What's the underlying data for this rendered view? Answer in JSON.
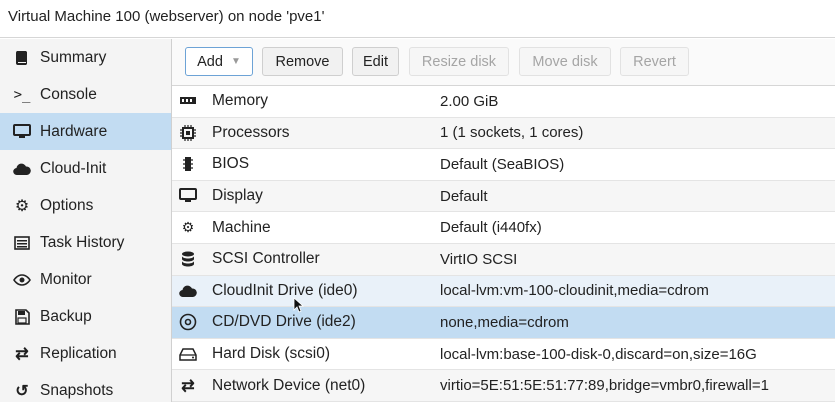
{
  "window": {
    "title": "Virtual Machine 100 (webserver) on node 'pve1'"
  },
  "sidebar": {
    "items": [
      {
        "label": "Summary",
        "icon": "book-icon"
      },
      {
        "label": "Console",
        "icon": "terminal-icon"
      },
      {
        "label": "Hardware",
        "icon": "monitor-icon",
        "active": true
      },
      {
        "label": "Cloud-Init",
        "icon": "cloud-icon"
      },
      {
        "label": "Options",
        "icon": "gear-icon"
      },
      {
        "label": "Task History",
        "icon": "list-icon"
      },
      {
        "label": "Monitor",
        "icon": "eye-icon"
      },
      {
        "label": "Backup",
        "icon": "floppy-icon"
      },
      {
        "label": "Replication",
        "icon": "retweet-icon"
      },
      {
        "label": "Snapshots",
        "icon": "history-icon"
      }
    ]
  },
  "toolbar": {
    "add": "Add",
    "remove": "Remove",
    "edit": "Edit",
    "resize": "Resize disk",
    "move": "Move disk",
    "revert": "Revert"
  },
  "hardware": {
    "rows": [
      {
        "name": "Memory",
        "value": "2.00 GiB",
        "icon": "memory-icon"
      },
      {
        "name": "Processors",
        "value": "1 (1 sockets, 1 cores)",
        "icon": "cpu-icon"
      },
      {
        "name": "BIOS",
        "value": "Default (SeaBIOS)",
        "icon": "chip-icon"
      },
      {
        "name": "Display",
        "value": "Default",
        "icon": "display-icon"
      },
      {
        "name": "Machine",
        "value": "Default (i440fx)",
        "icon": "cogs-icon"
      },
      {
        "name": "SCSI Controller",
        "value": "VirtIO SCSI",
        "icon": "database-icon"
      },
      {
        "name": "CloudInit Drive (ide0)",
        "value": "local-lvm:vm-100-cloudinit,media=cdrom",
        "icon": "cloud-icon"
      },
      {
        "name": "CD/DVD Drive (ide2)",
        "value": "none,media=cdrom",
        "icon": "disc-icon"
      },
      {
        "name": "Hard Disk (scsi0)",
        "value": "local-lvm:base-100-disk-0,discard=on,size=16G",
        "icon": "hdd-icon"
      },
      {
        "name": "Network Device (net0)",
        "value": "virtio=5E:51:5E:51:77:89,bridge=vmbr0,firewall=1",
        "icon": "exchange-icon"
      }
    ]
  },
  "colors": {
    "selected": "#c2dcf2",
    "hover": "#e9f1f9",
    "sidebar_bg": "#f4f4f4"
  }
}
